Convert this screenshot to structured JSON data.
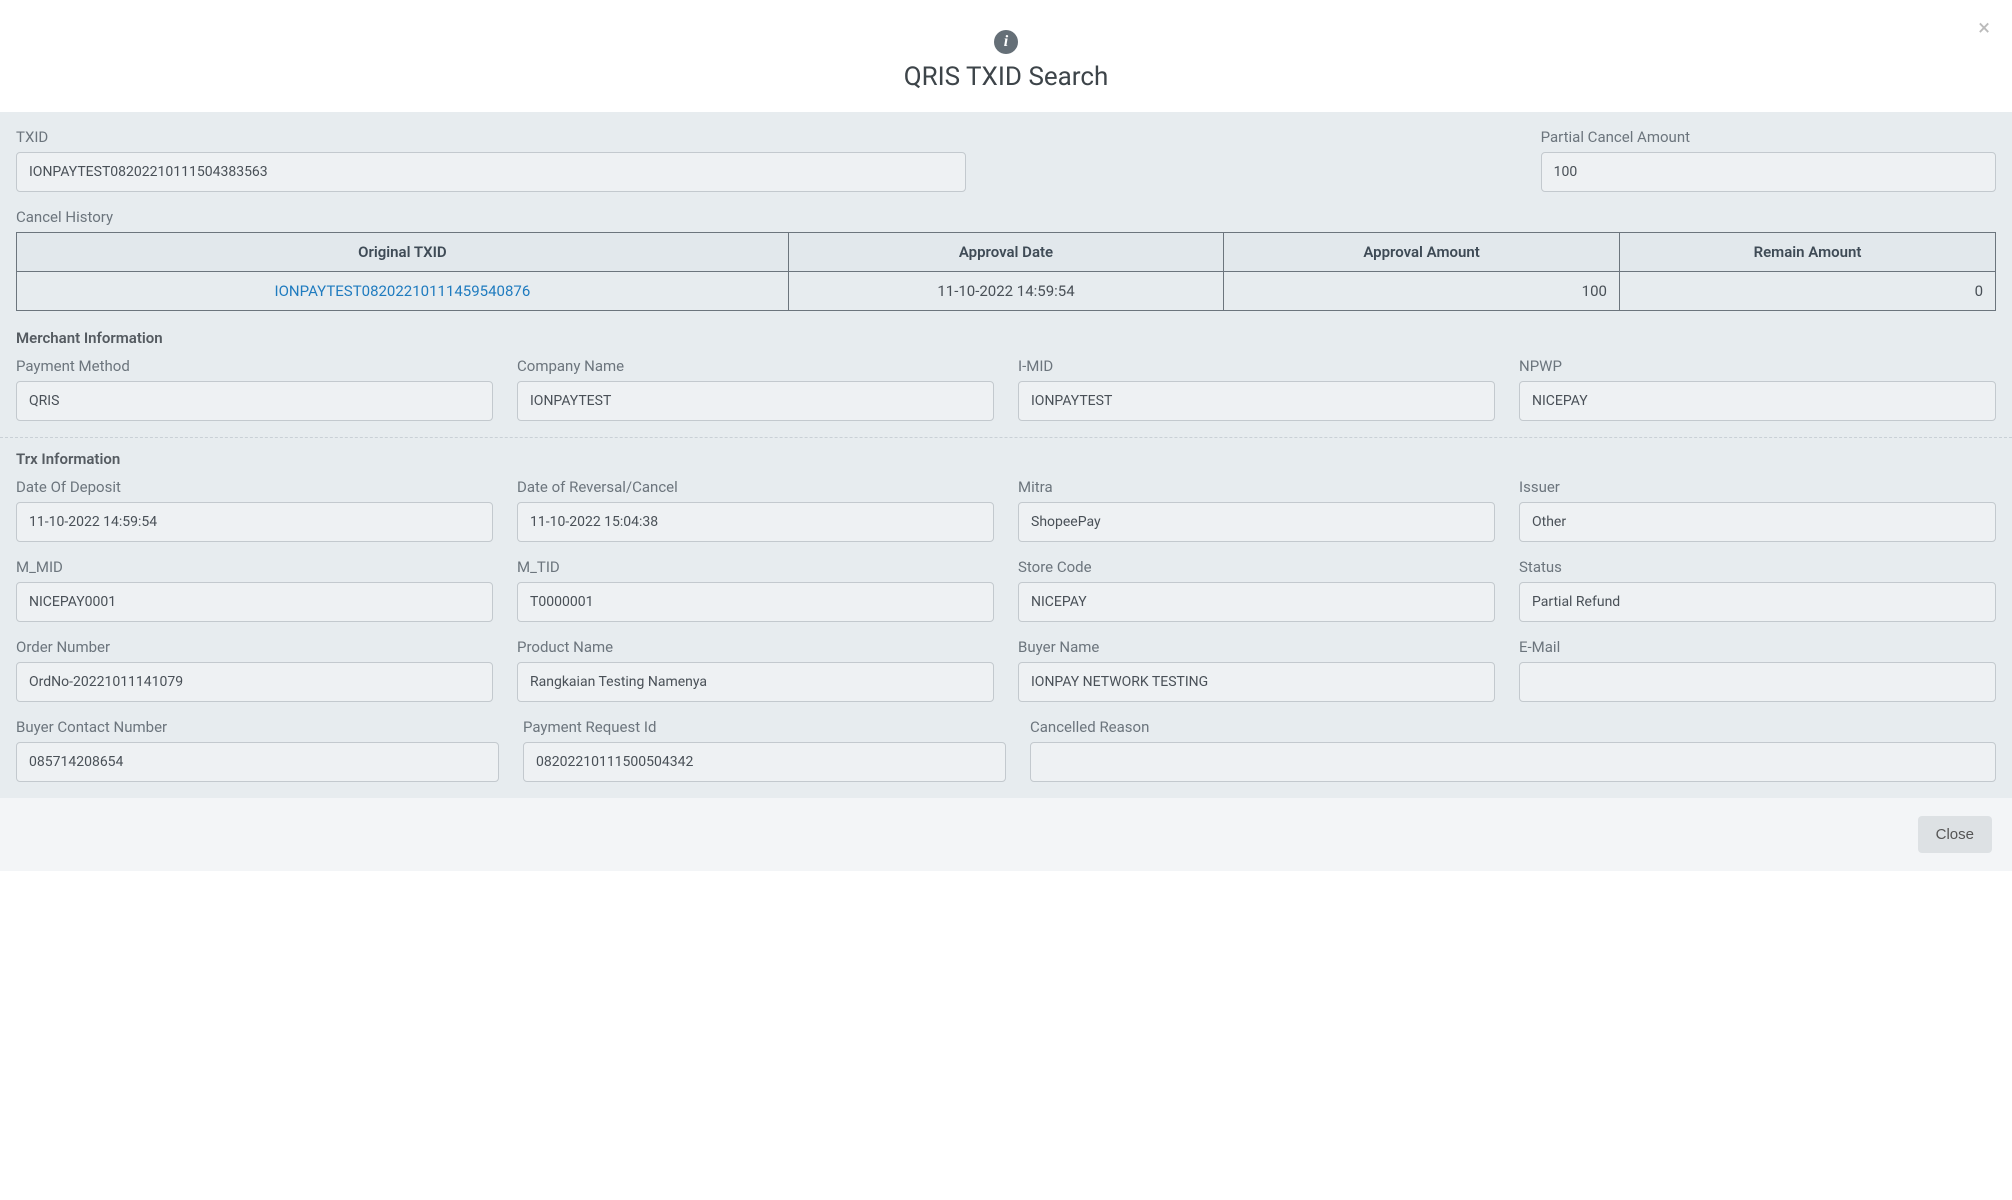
{
  "header": {
    "title": "QRIS TXID Search"
  },
  "txid": {
    "label": "TXID",
    "value": "IONPAYTEST08202210111504383563"
  },
  "partial_cancel": {
    "label": "Partial Cancel Amount",
    "value": "100"
  },
  "cancel_history": {
    "label": "Cancel History",
    "columns": {
      "orig": "Original TXID",
      "date": "Approval Date",
      "amount": "Approval Amount",
      "remain": "Remain Amount"
    },
    "row": {
      "orig": "IONPAYTEST08202210111459540876",
      "date": "11-10-2022 14:59:54",
      "amount": "100",
      "remain": "0"
    }
  },
  "merchant": {
    "title": "Merchant Information",
    "payment_method": {
      "label": "Payment Method",
      "value": "QRIS"
    },
    "company": {
      "label": "Company Name",
      "value": "IONPAYTEST"
    },
    "imid": {
      "label": "I-MID",
      "value": "IONPAYTEST"
    },
    "npwp": {
      "label": "NPWP",
      "value": "NICEPAY"
    }
  },
  "trx": {
    "title": "Trx Information",
    "date_deposit": {
      "label": "Date Of Deposit",
      "value": "11-10-2022 14:59:54"
    },
    "date_reversal": {
      "label": "Date of Reversal/Cancel",
      "value": "11-10-2022 15:04:38"
    },
    "mitra": {
      "label": "Mitra",
      "value": "ShopeePay"
    },
    "issuer": {
      "label": "Issuer",
      "value": "Other"
    },
    "m_mid": {
      "label": "M_MID",
      "value": "NICEPAY0001"
    },
    "m_tid": {
      "label": "M_TID",
      "value": "T0000001"
    },
    "store_code": {
      "label": "Store Code",
      "value": "NICEPAY"
    },
    "status": {
      "label": "Status",
      "value": "Partial Refund"
    },
    "order_no": {
      "label": "Order Number",
      "value": "OrdNo-20221011141079"
    },
    "product": {
      "label": "Product Name",
      "value": "Rangkaian Testing Namenya"
    },
    "buyer_name": {
      "label": "Buyer Name",
      "value": "IONPAY NETWORK TESTING"
    },
    "email": {
      "label": "E-Mail",
      "value": ""
    },
    "buyer_contact": {
      "label": "Buyer Contact Number",
      "value": "085714208654"
    },
    "payment_req": {
      "label": "Payment Request Id",
      "value": "08202210111500504342"
    },
    "cancelled_reason": {
      "label": "Cancelled Reason",
      "value": ""
    }
  },
  "footer": {
    "close": "Close"
  }
}
